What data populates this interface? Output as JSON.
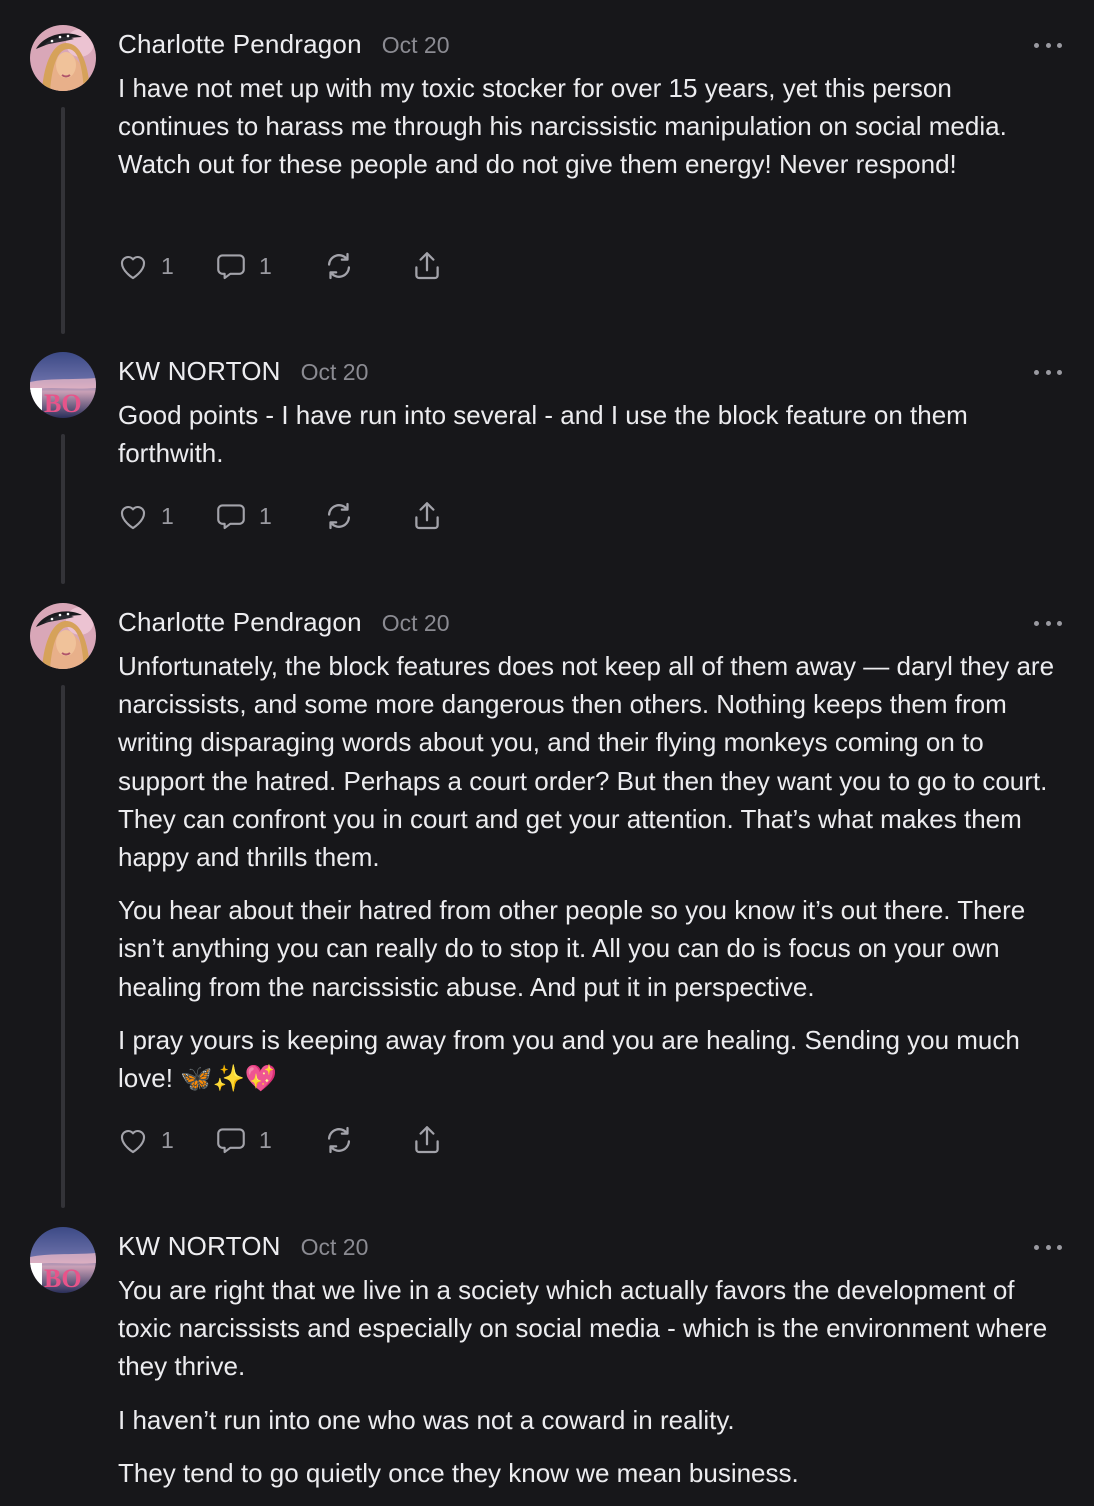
{
  "comments": [
    {
      "author": "Charlotte Pendragon",
      "date": "Oct 20",
      "avatar": "charlotte-avatar",
      "paragraphs": [
        "I have not met up with my toxic stocker for over 15 years, yet this person continues to harass me through his narcissistic manipulation on social media. Watch out for these people and do not give them energy! Never respond!"
      ],
      "likes": "1",
      "replies": "1"
    },
    {
      "author": "KW NORTON",
      "date": "Oct 20",
      "avatar": "kw-norton-avatar",
      "avatar_text": "BO",
      "paragraphs": [
        "Good points - I have run into several - and I use the block feature on them forthwith."
      ],
      "likes": "1",
      "replies": "1"
    },
    {
      "author": "Charlotte Pendragon",
      "date": "Oct 20",
      "avatar": "charlotte-avatar",
      "paragraphs": [
        "Unfortunately, the block features does not keep all of them away — daryl they are narcissists, and some more dangerous then others. Nothing keeps them from writing disparaging words about you, and their flying monkeys coming on to support the hatred. Perhaps a court order? But then they want you to go to court. They can confront you in court and get your attention. That’s what makes them happy and thrills them.",
        "You hear about their hatred from other people so you know it’s out there. There isn’t anything you can really do to stop it. All you can do is focus on your own healing from the narcissistic abuse. And put it in perspective.",
        "I pray yours is keeping away from you and you are healing. Sending you much love! 🦋✨💖"
      ],
      "likes": "1",
      "replies": "1"
    },
    {
      "author": "KW NORTON",
      "date": "Oct 20",
      "avatar": "kw-norton-avatar",
      "avatar_text": "BO",
      "paragraphs": [
        "You are right that we live in a society which actually favors the development of toxic narcissists and especially on social media - which is the environment where they thrive.",
        "I haven’t run into one who was not a coward in reality.",
        "They tend to go quietly once they know we mean business."
      ]
    }
  ],
  "icons": {
    "like": "heart-icon",
    "reply": "comment-bubble-icon",
    "restack": "restack-icon",
    "share": "share-icon",
    "more": "more-options-icon"
  },
  "colors": {
    "background": "#17171a",
    "text": "#ececef",
    "muted": "#8b8b92",
    "thread_line": "#333338"
  }
}
